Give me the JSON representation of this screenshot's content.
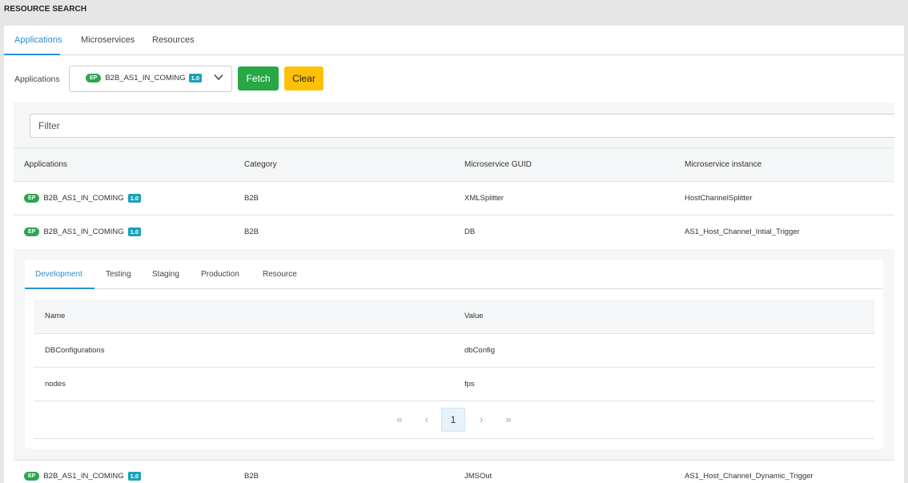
{
  "page_title": "RESOURCE SEARCH",
  "tabs": [
    {
      "label": "Applications",
      "active": true
    },
    {
      "label": "Microservices",
      "active": false
    },
    {
      "label": "Resources",
      "active": false
    }
  ],
  "selector": {
    "label": "Applications",
    "selected": {
      "badge": "EP",
      "name": "B2B_AS1_IN_COMING",
      "version": "1.0"
    }
  },
  "buttons": {
    "fetch": "Fetch",
    "clear": "Clear"
  },
  "filter": {
    "placeholder": "Filter"
  },
  "table": {
    "columns": [
      "Applications",
      "Category",
      "Microservice GUID",
      "Microservice instance"
    ],
    "rows": [
      {
        "badge": "EP",
        "app": "B2B_AS1_IN_COMING",
        "version": "1.0",
        "category": "B2B",
        "guid": "XMLSplitter",
        "instance": "HostChannelSplitter"
      },
      {
        "badge": "EP",
        "app": "B2B_AS1_IN_COMING",
        "version": "1.0",
        "category": "B2B",
        "guid": "DB",
        "instance": "AS1_Host_Channel_Intial_Trigger"
      },
      {
        "badge": "EP",
        "app": "B2B_AS1_IN_COMING",
        "version": "1.0",
        "category": "B2B",
        "guid": "JMSOut",
        "instance": "AS1_Host_Channel_Dynamic_Trigger"
      }
    ]
  },
  "detail": {
    "tabs": [
      {
        "label": "Development",
        "active": true
      },
      {
        "label": "Testing",
        "active": false
      },
      {
        "label": "Staging",
        "active": false
      },
      {
        "label": "Production",
        "active": false
      },
      {
        "label": "Resource",
        "active": false
      }
    ],
    "columns": [
      "Name",
      "Value"
    ],
    "rows": [
      {
        "name": "DBConfigurations",
        "value": "dbConfig"
      },
      {
        "name": "nodes",
        "value": "fps"
      }
    ],
    "pagination": {
      "first": "«",
      "prev": "‹",
      "current": "1",
      "next": "›",
      "last": "»"
    }
  },
  "colors": {
    "accent": "#2a8fd4",
    "fetch": "#28a745",
    "clear": "#ffc107",
    "ep_badge": "#2ea44f",
    "version_badge": "#17a2b8"
  }
}
